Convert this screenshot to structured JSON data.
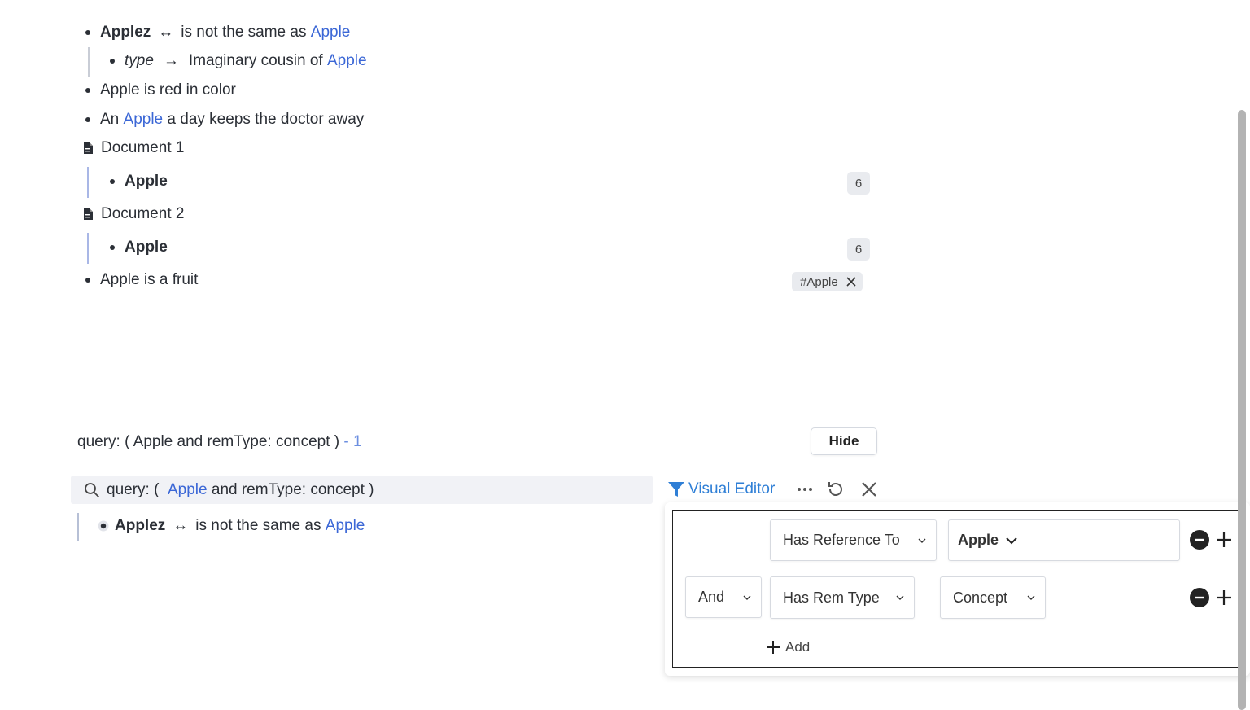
{
  "document": {
    "items": [
      {
        "name": "Applez",
        "relation": "is not the same as",
        "ref": "Apple"
      },
      {
        "prop": "type",
        "value": "Imaginary cousin of",
        "ref": "Apple"
      },
      {
        "text": "Apple is red in color"
      },
      {
        "pre": "An",
        "ref": "Apple",
        "post": "a day keeps the doctor away"
      },
      {
        "title": "Document 1",
        "child": "Apple",
        "count": "6"
      },
      {
        "title": "Document 2",
        "child": "Apple",
        "count": "6"
      },
      {
        "text": "Apple is a fruit",
        "tag": "#Apple"
      }
    ]
  },
  "query": {
    "header_label": "query: ( Apple and remType: concept )",
    "header_count": "- 1",
    "hide_label": "Hide",
    "search_prefix": "query: (",
    "search_ref": "Apple",
    "search_suffix": "and remType: concept )",
    "result": {
      "name": "Applez",
      "relation": "is not the same as",
      "ref": "Apple"
    }
  },
  "toolbar": {
    "visual_editor_label": "Visual Editor"
  },
  "filters": {
    "row1": {
      "condition": "Has Reference To",
      "value": "Apple"
    },
    "row2": {
      "connector": "And",
      "condition": "Has Rem Type",
      "value": "Concept"
    },
    "add_label": "Add"
  },
  "colors": {
    "link": "#3b67d6",
    "filter_icon": "#2f7fd6"
  }
}
